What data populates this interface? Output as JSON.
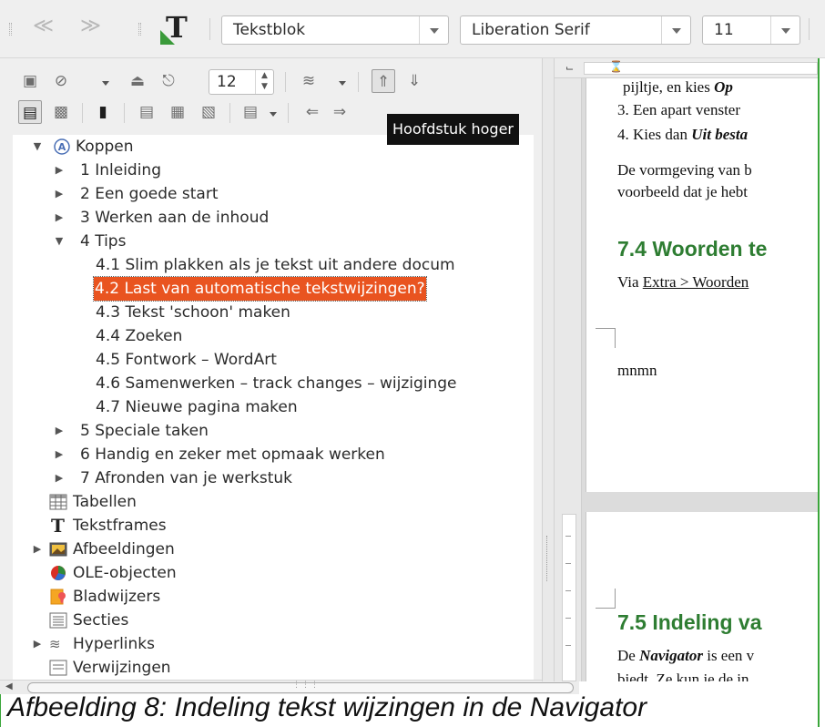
{
  "toolbar": {
    "paragraph_style": "Tekstblok",
    "font_name": "Liberation Serif",
    "font_size": "11",
    "back_icon": "back-arrow-icon",
    "forward_icon": "forward-arrow-icon",
    "style_icon": "text-style-T-icon"
  },
  "navigator": {
    "toolbar": {
      "spin_value": "12",
      "tooltip": "Hoofdstuk hoger"
    },
    "tree": {
      "headings_label": "Koppen",
      "chapters": [
        "1 Inleiding",
        "2 Een goede start",
        "3 Werken aan de inhoud",
        "4 Tips"
      ],
      "tips": [
        "4.1 Slim plakken als je tekst uit andere docum",
        "4.2 Last van automatische tekstwijzingen?",
        "4.3 Tekst 'schoon' maken",
        "4.4 Zoeken",
        "4.5 Fontwork – WordArt",
        "4.6 Samenwerken – track changes – wijziginge",
        "4.7 Nieuwe pagina maken"
      ],
      "chapters_after": [
        "5 Speciale taken",
        "6 Handig en zeker met opmaak werken",
        "7 Afronden van je werkstuk"
      ],
      "categories": [
        "Tabellen",
        "Tekstframes",
        "Afbeeldingen",
        "OLE-objecten",
        "Bladwijzers",
        "Secties",
        "Hyperlinks",
        "Verwijzingen"
      ],
      "selected_item": "4.2 Last van automatische tekstwijzingen?"
    }
  },
  "document": {
    "page1_lines": {
      "l1_pre": "pijltje, en kies ",
      "l1_em": "Op",
      "l2": "3.  Een apart venster",
      "l3_pre": "4.  Kies dan ",
      "l3_em": "Uit besta",
      "p1": "De vormgeving van b",
      "p2": "voorbeeld dat je hebt",
      "heading": "7.4   Woorden te",
      "via_pre": "Via ",
      "via_link": "Extra > Woorden",
      "mnmn": "mnmn"
    },
    "page2_lines": {
      "heading": "7.5   Indeling va",
      "nav_pre": "De ",
      "nav_em": "Navigator",
      "nav_post": " is een v",
      "cut": "biedt. Ze kun je de in"
    }
  },
  "caption": "Afbeelding 8: Indeling tekst wijzingen in de Navigator",
  "colors": {
    "selection": "#e95420",
    "heading_green": "#2e7d32",
    "frame_green": "#3aa63a"
  }
}
